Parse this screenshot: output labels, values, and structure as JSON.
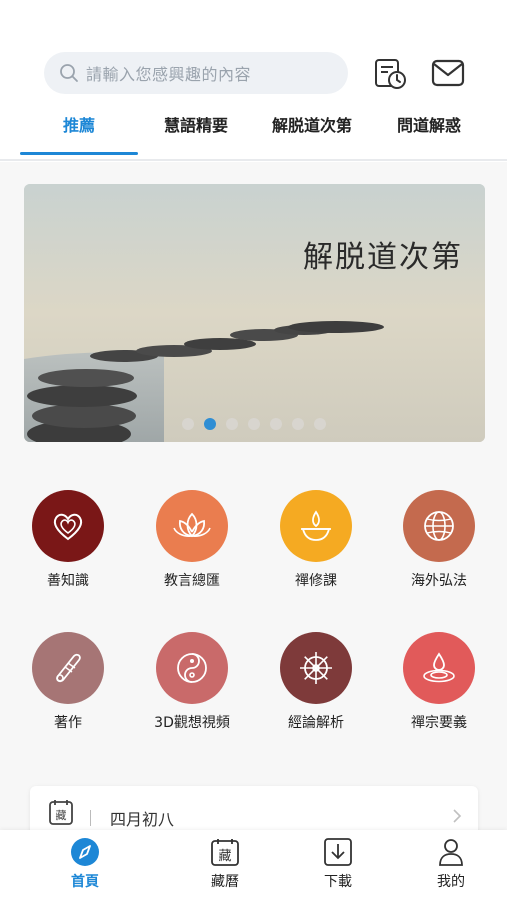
{
  "header": {
    "search": {
      "placeholder": "請輸入您感興趣的內容"
    },
    "icons": {
      "history": "history-calendar-icon",
      "mail": "mail-icon"
    }
  },
  "tabs": [
    {
      "label": "推薦",
      "active": true
    },
    {
      "label": "慧語精要",
      "active": false
    },
    {
      "label": "解脱道次第",
      "active": false
    },
    {
      "label": "問道解惑",
      "active": false
    }
  ],
  "banner": {
    "title": "解脱道次第",
    "dots": {
      "count": 7,
      "active_index": 1
    }
  },
  "features": [
    {
      "label": "善知識",
      "color": "#7a1717",
      "icon": "heart-icon"
    },
    {
      "label": "教言總匯",
      "color": "#ea7d4f",
      "icon": "lotus-icon"
    },
    {
      "label": "禪修課",
      "color": "#f5aa22",
      "icon": "oil-lamp-icon"
    },
    {
      "label": "海外弘法",
      "color": "#c46a4e",
      "icon": "globe-icon"
    },
    {
      "label": "著作",
      "color": "#a67575",
      "icon": "scroll-icon"
    },
    {
      "label": "3D觀想視頻",
      "color": "#c96a6a",
      "icon": "yin-yang-icon"
    },
    {
      "label": "經論解析",
      "color": "#7e3a3a",
      "icon": "dharma-wheel-icon"
    },
    {
      "label": "禪宗要義",
      "color": "#e15a5a",
      "icon": "water-drop-icon"
    }
  ],
  "calendar": {
    "icon_char": "藏",
    "date_text": "四月初八"
  },
  "bottom_nav": [
    {
      "label": "首頁",
      "icon": "compass-icon",
      "active": true
    },
    {
      "label": "藏曆",
      "icon": "tibetan-calendar-icon",
      "icon_char": "藏",
      "active": false
    },
    {
      "label": "下載",
      "icon": "download-icon",
      "active": false
    },
    {
      "label": "我的",
      "icon": "user-icon",
      "active": false
    }
  ],
  "colors": {
    "accent": "#1d87d6",
    "background": "#f7f7f7"
  }
}
